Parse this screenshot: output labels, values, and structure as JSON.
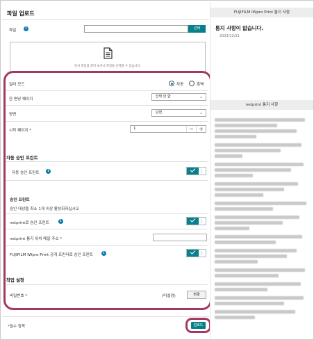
{
  "upload": {
    "title": "파일 업로드",
    "file_label": "파일",
    "select_button": "선택",
    "drop_text": "문서 파일을 끌어 놓거나 파일을 선택할 수 있습니다.",
    "color_mode_label": "컬러 모드",
    "color_option": "자동",
    "mono_option": "흑백",
    "pages_per_sheet_label": "한 면당 페이지",
    "pages_per_sheet_value": "선택 안 함",
    "duplex_label": "양면",
    "duplex_value": "단면",
    "start_page_label": "시작 페이지 *",
    "start_page_value": "1",
    "stepper_minus": "−",
    "stepper_plus": "+",
    "auto_print_section": "자동 승인 프린트",
    "auto_print_label": "자동 승인 프린트",
    "approval_section": "승인 프린트",
    "approval_hint": "승인 대상을 최소 1개 이상 활성화하십시오",
    "netprint_approval_label": "netprint로 승인 프린트",
    "netprint_email_label": "netprint 통지 위치 메일 주소 *",
    "netprint_email_value": "",
    "fujifilm_approval_label": "FUJIFILM IWpro Print 공개 프린터로 승인 프린트",
    "job_section": "작업 설정",
    "password_label": "비밀번호 *",
    "password_status": "(미설정)",
    "change_button": "변경",
    "required_note": "*필수 항목",
    "upload_button": "업로드",
    "info_glyph": "i"
  },
  "toggles": {
    "auto_print": true,
    "netprint_approval": true,
    "fujifilm_approval": true
  },
  "notices": {
    "iwpro_title": "FUJIFILM IWpro Print 통지 사항",
    "iwpro_message": "통지 사항이 없습니다.",
    "iwpro_date": "2023/12/21",
    "netprint_title": "netprint 통지 사항"
  },
  "colors": {
    "accent": "#0a7f8c",
    "info": "#0a7ab5",
    "highlight": "#a33863"
  }
}
